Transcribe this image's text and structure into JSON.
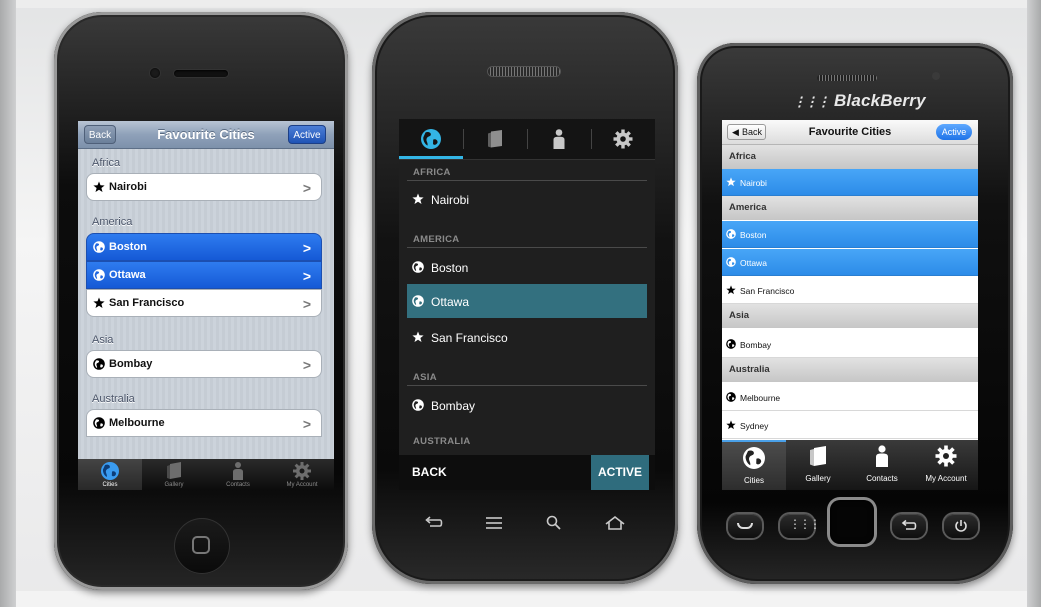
{
  "colors": {
    "ios_selected": "#1f66e0",
    "android_accent": "#33b5e5",
    "android_selected": "#33707f",
    "bb_selected": "#3a9af0"
  },
  "iphone": {
    "nav": {
      "title": "Favourite Cities",
      "back_label": "Back",
      "active_label": "Active"
    },
    "sections": [
      {
        "header": "Africa",
        "items": [
          {
            "label": "Nairobi",
            "icon": "star-icon",
            "selected": false
          }
        ]
      },
      {
        "header": "America",
        "items": [
          {
            "label": "Boston",
            "icon": "globe-icon",
            "selected": true
          },
          {
            "label": "Ottawa",
            "icon": "globe-icon",
            "selected": true
          },
          {
            "label": "San Francisco",
            "icon": "star-icon",
            "selected": false
          }
        ]
      },
      {
        "header": "Asia",
        "items": [
          {
            "label": "Bombay",
            "icon": "globe-icon",
            "selected": false
          }
        ]
      },
      {
        "header": "Australia",
        "items": [
          {
            "label": "Melbourne",
            "icon": "globe-icon",
            "selected": false
          }
        ]
      }
    ],
    "tabs": [
      {
        "label": "Cities",
        "icon": "globe-icon",
        "active": true
      },
      {
        "label": "Gallery",
        "icon": "gallery-icon",
        "active": false
      },
      {
        "label": "Contacts",
        "icon": "contacts-icon",
        "active": false
      },
      {
        "label": "My Account",
        "icon": "gear-icon",
        "active": false
      }
    ]
  },
  "android": {
    "tabs": [
      {
        "icon": "globe-icon",
        "active": true
      },
      {
        "icon": "gallery-icon",
        "active": false
      },
      {
        "icon": "contacts-icon",
        "active": false
      },
      {
        "icon": "gear-icon",
        "active": false
      }
    ],
    "sections": [
      {
        "header": "AFRICA",
        "items": [
          {
            "label": "Nairobi",
            "icon": "star-icon",
            "selected": false
          }
        ]
      },
      {
        "header": "AMERICA",
        "items": [
          {
            "label": "Boston",
            "icon": "globe-icon",
            "selected": false
          },
          {
            "label": "Ottawa",
            "icon": "globe-icon",
            "selected": true
          },
          {
            "label": "San Francisco",
            "icon": "star-icon",
            "selected": false
          }
        ]
      },
      {
        "header": "ASIA",
        "items": [
          {
            "label": "Bombay",
            "icon": "globe-icon",
            "selected": false
          }
        ]
      },
      {
        "header": "AUSTRALIA",
        "items": []
      }
    ],
    "bottom": {
      "back_label": "BACK",
      "active_label": "ACTIVE"
    },
    "softkeys": [
      "back-icon",
      "menu-icon",
      "search-icon",
      "home-icon"
    ]
  },
  "blackberry": {
    "brand": "BlackBerry",
    "nav": {
      "title": "Favourite Cities",
      "back_label": "Back",
      "active_label": "Active"
    },
    "sections": [
      {
        "header": "Africa",
        "items": [
          {
            "label": "Nairobi",
            "icon": "star-icon",
            "selected": true
          }
        ]
      },
      {
        "header": "America",
        "items": [
          {
            "label": "Boston",
            "icon": "globe-icon",
            "selected": true
          },
          {
            "label": "Ottawa",
            "icon": "globe-icon",
            "selected": true
          },
          {
            "label": "San Francisco",
            "icon": "star-icon",
            "selected": false
          }
        ]
      },
      {
        "header": "Asia",
        "items": [
          {
            "label": "Bombay",
            "icon": "globe-icon",
            "selected": false
          }
        ]
      },
      {
        "header": "Australia",
        "items": [
          {
            "label": "Melbourne",
            "icon": "globe-icon",
            "selected": false
          },
          {
            "label": "Sydney",
            "icon": "star-icon",
            "selected": false
          }
        ]
      }
    ],
    "tabs": [
      {
        "label": "Cities",
        "icon": "globe-icon",
        "active": true
      },
      {
        "label": "Gallery",
        "icon": "gallery-icon",
        "active": false
      },
      {
        "label": "Contacts",
        "icon": "contacts-icon",
        "active": false
      },
      {
        "label": "My Account",
        "icon": "gear-icon",
        "active": false
      }
    ]
  }
}
